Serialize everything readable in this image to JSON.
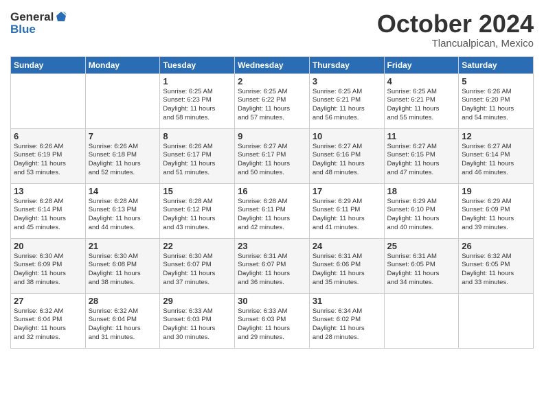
{
  "header": {
    "logo_line1": "General",
    "logo_line2": "Blue",
    "month": "October 2024",
    "location": "Tlancualpican, Mexico"
  },
  "days_of_week": [
    "Sunday",
    "Monday",
    "Tuesday",
    "Wednesday",
    "Thursday",
    "Friday",
    "Saturday"
  ],
  "weeks": [
    [
      {
        "day": "",
        "text": ""
      },
      {
        "day": "",
        "text": ""
      },
      {
        "day": "1",
        "text": "Sunrise: 6:25 AM\nSunset: 6:23 PM\nDaylight: 11 hours and 58 minutes."
      },
      {
        "day": "2",
        "text": "Sunrise: 6:25 AM\nSunset: 6:22 PM\nDaylight: 11 hours and 57 minutes."
      },
      {
        "day": "3",
        "text": "Sunrise: 6:25 AM\nSunset: 6:21 PM\nDaylight: 11 hours and 56 minutes."
      },
      {
        "day": "4",
        "text": "Sunrise: 6:25 AM\nSunset: 6:21 PM\nDaylight: 11 hours and 55 minutes."
      },
      {
        "day": "5",
        "text": "Sunrise: 6:26 AM\nSunset: 6:20 PM\nDaylight: 11 hours and 54 minutes."
      }
    ],
    [
      {
        "day": "6",
        "text": "Sunrise: 6:26 AM\nSunset: 6:19 PM\nDaylight: 11 hours and 53 minutes."
      },
      {
        "day": "7",
        "text": "Sunrise: 6:26 AM\nSunset: 6:18 PM\nDaylight: 11 hours and 52 minutes."
      },
      {
        "day": "8",
        "text": "Sunrise: 6:26 AM\nSunset: 6:17 PM\nDaylight: 11 hours and 51 minutes."
      },
      {
        "day": "9",
        "text": "Sunrise: 6:27 AM\nSunset: 6:17 PM\nDaylight: 11 hours and 50 minutes."
      },
      {
        "day": "10",
        "text": "Sunrise: 6:27 AM\nSunset: 6:16 PM\nDaylight: 11 hours and 48 minutes."
      },
      {
        "day": "11",
        "text": "Sunrise: 6:27 AM\nSunset: 6:15 PM\nDaylight: 11 hours and 47 minutes."
      },
      {
        "day": "12",
        "text": "Sunrise: 6:27 AM\nSunset: 6:14 PM\nDaylight: 11 hours and 46 minutes."
      }
    ],
    [
      {
        "day": "13",
        "text": "Sunrise: 6:28 AM\nSunset: 6:14 PM\nDaylight: 11 hours and 45 minutes."
      },
      {
        "day": "14",
        "text": "Sunrise: 6:28 AM\nSunset: 6:13 PM\nDaylight: 11 hours and 44 minutes."
      },
      {
        "day": "15",
        "text": "Sunrise: 6:28 AM\nSunset: 6:12 PM\nDaylight: 11 hours and 43 minutes."
      },
      {
        "day": "16",
        "text": "Sunrise: 6:28 AM\nSunset: 6:11 PM\nDaylight: 11 hours and 42 minutes."
      },
      {
        "day": "17",
        "text": "Sunrise: 6:29 AM\nSunset: 6:11 PM\nDaylight: 11 hours and 41 minutes."
      },
      {
        "day": "18",
        "text": "Sunrise: 6:29 AM\nSunset: 6:10 PM\nDaylight: 11 hours and 40 minutes."
      },
      {
        "day": "19",
        "text": "Sunrise: 6:29 AM\nSunset: 6:09 PM\nDaylight: 11 hours and 39 minutes."
      }
    ],
    [
      {
        "day": "20",
        "text": "Sunrise: 6:30 AM\nSunset: 6:09 PM\nDaylight: 11 hours and 38 minutes."
      },
      {
        "day": "21",
        "text": "Sunrise: 6:30 AM\nSunset: 6:08 PM\nDaylight: 11 hours and 38 minutes."
      },
      {
        "day": "22",
        "text": "Sunrise: 6:30 AM\nSunset: 6:07 PM\nDaylight: 11 hours and 37 minutes."
      },
      {
        "day": "23",
        "text": "Sunrise: 6:31 AM\nSunset: 6:07 PM\nDaylight: 11 hours and 36 minutes."
      },
      {
        "day": "24",
        "text": "Sunrise: 6:31 AM\nSunset: 6:06 PM\nDaylight: 11 hours and 35 minutes."
      },
      {
        "day": "25",
        "text": "Sunrise: 6:31 AM\nSunset: 6:05 PM\nDaylight: 11 hours and 34 minutes."
      },
      {
        "day": "26",
        "text": "Sunrise: 6:32 AM\nSunset: 6:05 PM\nDaylight: 11 hours and 33 minutes."
      }
    ],
    [
      {
        "day": "27",
        "text": "Sunrise: 6:32 AM\nSunset: 6:04 PM\nDaylight: 11 hours and 32 minutes."
      },
      {
        "day": "28",
        "text": "Sunrise: 6:32 AM\nSunset: 6:04 PM\nDaylight: 11 hours and 31 minutes."
      },
      {
        "day": "29",
        "text": "Sunrise: 6:33 AM\nSunset: 6:03 PM\nDaylight: 11 hours and 30 minutes."
      },
      {
        "day": "30",
        "text": "Sunrise: 6:33 AM\nSunset: 6:03 PM\nDaylight: 11 hours and 29 minutes."
      },
      {
        "day": "31",
        "text": "Sunrise: 6:34 AM\nSunset: 6:02 PM\nDaylight: 11 hours and 28 minutes."
      },
      {
        "day": "",
        "text": ""
      },
      {
        "day": "",
        "text": ""
      }
    ]
  ]
}
